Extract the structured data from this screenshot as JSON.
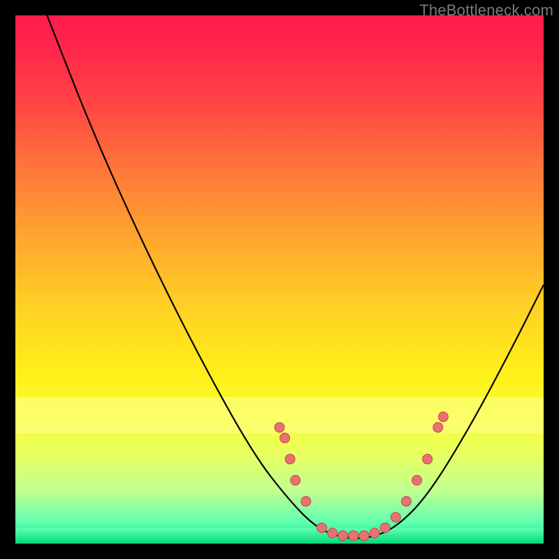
{
  "attribution": "TheBottleneck.com",
  "colors": {
    "dot_fill": "#e87272",
    "dot_stroke": "#c04848",
    "curve": "#000000"
  },
  "chart_data": {
    "type": "line",
    "title": "",
    "xlabel": "",
    "ylabel": "",
    "xlim": [
      0,
      100
    ],
    "ylim": [
      0,
      100
    ],
    "curve_points": [
      {
        "x": 6,
        "y": 100
      },
      {
        "x": 15,
        "y": 77
      },
      {
        "x": 25,
        "y": 55
      },
      {
        "x": 35,
        "y": 35
      },
      {
        "x": 45,
        "y": 17
      },
      {
        "x": 52,
        "y": 8
      },
      {
        "x": 57,
        "y": 3
      },
      {
        "x": 62,
        "y": 1
      },
      {
        "x": 67,
        "y": 1
      },
      {
        "x": 72,
        "y": 3
      },
      {
        "x": 78,
        "y": 9
      },
      {
        "x": 86,
        "y": 22
      },
      {
        "x": 94,
        "y": 37
      },
      {
        "x": 100,
        "y": 49
      }
    ],
    "series": [
      {
        "name": "markers",
        "points": [
          {
            "x": 50,
            "y": 22
          },
          {
            "x": 51,
            "y": 20
          },
          {
            "x": 52,
            "y": 16
          },
          {
            "x": 53,
            "y": 12
          },
          {
            "x": 55,
            "y": 8
          },
          {
            "x": 58,
            "y": 3
          },
          {
            "x": 60,
            "y": 2
          },
          {
            "x": 62,
            "y": 1.5
          },
          {
            "x": 64,
            "y": 1.5
          },
          {
            "x": 66,
            "y": 1.5
          },
          {
            "x": 68,
            "y": 2
          },
          {
            "x": 70,
            "y": 3
          },
          {
            "x": 72,
            "y": 5
          },
          {
            "x": 74,
            "y": 8
          },
          {
            "x": 76,
            "y": 12
          },
          {
            "x": 78,
            "y": 16
          },
          {
            "x": 80,
            "y": 22
          },
          {
            "x": 81,
            "y": 24
          }
        ]
      }
    ]
  }
}
